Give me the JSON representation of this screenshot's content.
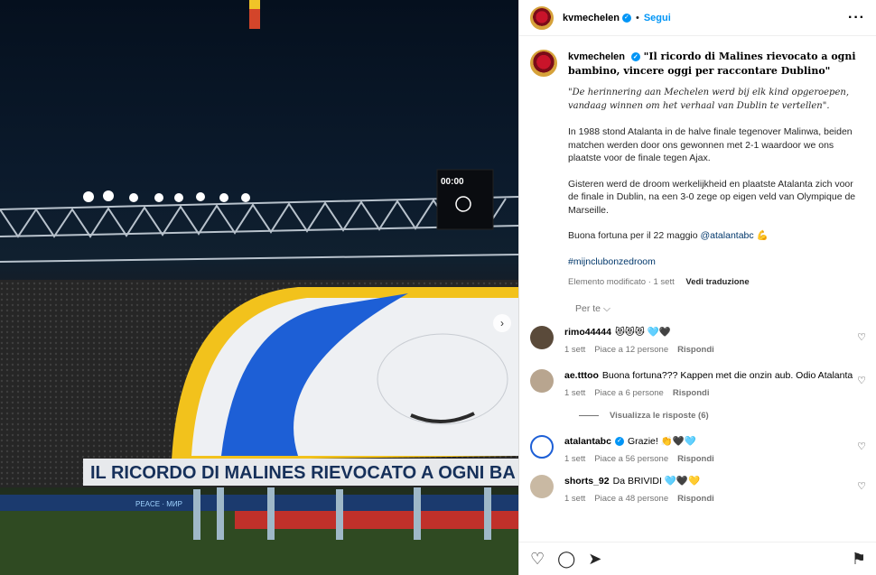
{
  "photo": {
    "scoreboard": "00:00",
    "banner_text": "IL RICORDO DI MALINES RIEVOCATO A OGNI BA",
    "ad_text": "PEACE · МИР",
    "colors": {
      "sky": "#0b1a2c",
      "blue": "#1d5fd6",
      "yellow": "#f2c21c",
      "white": "#eef0f3",
      "pitch": "#2f4a22"
    }
  },
  "header": {
    "username": "kvmechelen",
    "follow_label": "Segui",
    "more_icon": "more-horizontal-icon"
  },
  "caption": {
    "username": "kvmechelen",
    "headline": "\"Il ricordo di Malines rievocato a ogni bambino, vincere oggi per raccontare Dublino\"",
    "italic": "\"De herinnering aan Mechelen werd bij elk kind opgeroepen, vandaag winnen om het verhaal van Dublin te vertellen\".",
    "paragraph1": "In 1988 stond Atalanta in de halve finale tegenover Malinwa, beiden matchen werden door ons gewonnen met 2-1 waardoor we ons plaatste voor de finale tegen Ajax.",
    "paragraph2": "Gisteren werd de droom werkelijkheid en plaatste Atalanta zich voor de finale in Dublin, na een 3-0 zege op eigen veld van Olympique de Marseille.",
    "paragraph3_prefix": "Buona fortuna per il 22 maggio ",
    "mention": "@atalantabc",
    "emoji": "💪",
    "hashtag": "#mijnclubonzedroom",
    "edited": "Elemento modificato · 1 sett",
    "translate": "Vedi traduzione"
  },
  "per_te": "Per te",
  "comments": [
    {
      "user": "rimo44444",
      "text": "😻😻😻 🩵🖤",
      "time": "1 sett",
      "likes": "Piace a 12 persone",
      "reply": "Rispondi",
      "avatar_color": "#5a4a3a"
    },
    {
      "user": "ae.tttoo",
      "text": "Buona fortuna??? Kappen met die onzin aub. Odio Atalanta",
      "time": "1 sett",
      "likes": "Piace a 6 persone",
      "reply": "Rispondi",
      "avatar_color": "#b8a58f"
    },
    {
      "user": "atalantabc",
      "text": "Grazie! 👏🖤🩵",
      "time": "1 sett",
      "likes": "Piace a 56 persone",
      "reply": "Rispondi",
      "avatar_color": "#1d5fd6"
    },
    {
      "user": "shorts_92",
      "text": "Da BRIVIDI 🩵🖤💛",
      "time": "1 sett",
      "likes": "Piace a 48 persone",
      "reply": "Rispondi",
      "avatar_color": "#c9b9a3"
    }
  ],
  "view_replies": "Visualizza le risposte (6)",
  "actions": {
    "like": "heart-icon",
    "comment": "comment-icon",
    "share": "share-icon",
    "save": "bookmark-icon"
  }
}
